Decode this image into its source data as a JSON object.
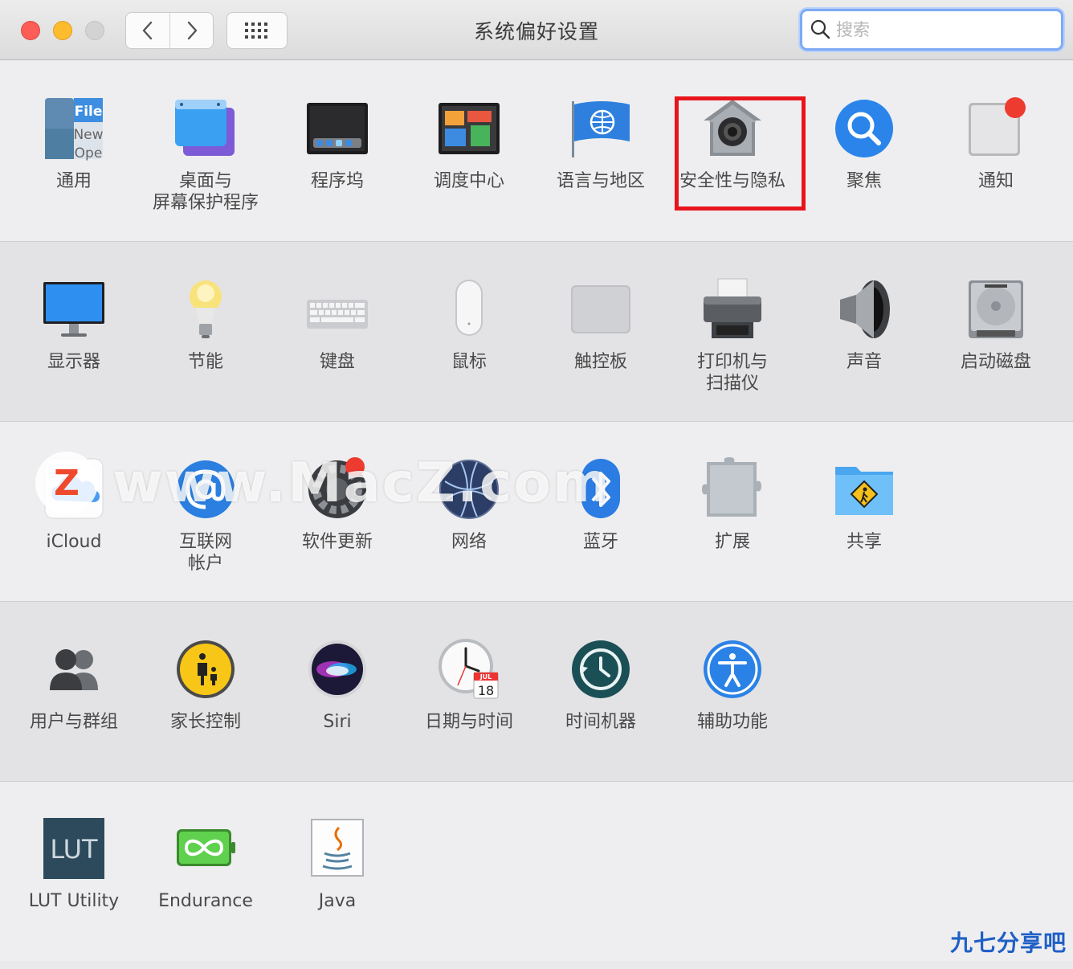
{
  "window": {
    "title": "系统偏好设置",
    "search_placeholder": "搜索"
  },
  "panes": {
    "general": "通用",
    "desktop": "桌面与\n屏幕保护程序",
    "dock": "程序坞",
    "mission_control": "调度中心",
    "language": "语言与地区",
    "security": "安全性与隐私",
    "spotlight": "聚焦",
    "notifications": "通知",
    "displays": "显示器",
    "energy": "节能",
    "keyboard": "键盘",
    "mouse": "鼠标",
    "trackpad": "触控板",
    "printers": "打印机与\n扫描仪",
    "sound": "声音",
    "startup_disk": "启动磁盘",
    "icloud": "iCloud",
    "internet_accounts": "互联网\n帐户",
    "software_update": "软件更新",
    "network": "网络",
    "bluetooth": "蓝牙",
    "extensions": "扩展",
    "sharing": "共享",
    "users": "用户与群组",
    "parental": "家长控制",
    "siri": "Siri",
    "datetime": "日期与时间",
    "timemachine": "时间机器",
    "accessibility": "辅助功能",
    "lut": "LUT Utility",
    "endurance": "Endurance",
    "java": "Java"
  },
  "icon_text": {
    "general_file": "File",
    "general_new": "New",
    "general_open": "Ope",
    "calendar_month": "JUL",
    "calendar_day": "18",
    "lut_logo": "LUT"
  },
  "watermark": {
    "text": "www.MacZ.com",
    "logo_letter": "Z"
  },
  "corner_watermark": "九七分享吧",
  "colors": {
    "highlight": "#e8141b",
    "close": "#fc5d57",
    "minimize": "#fdbb2e"
  }
}
